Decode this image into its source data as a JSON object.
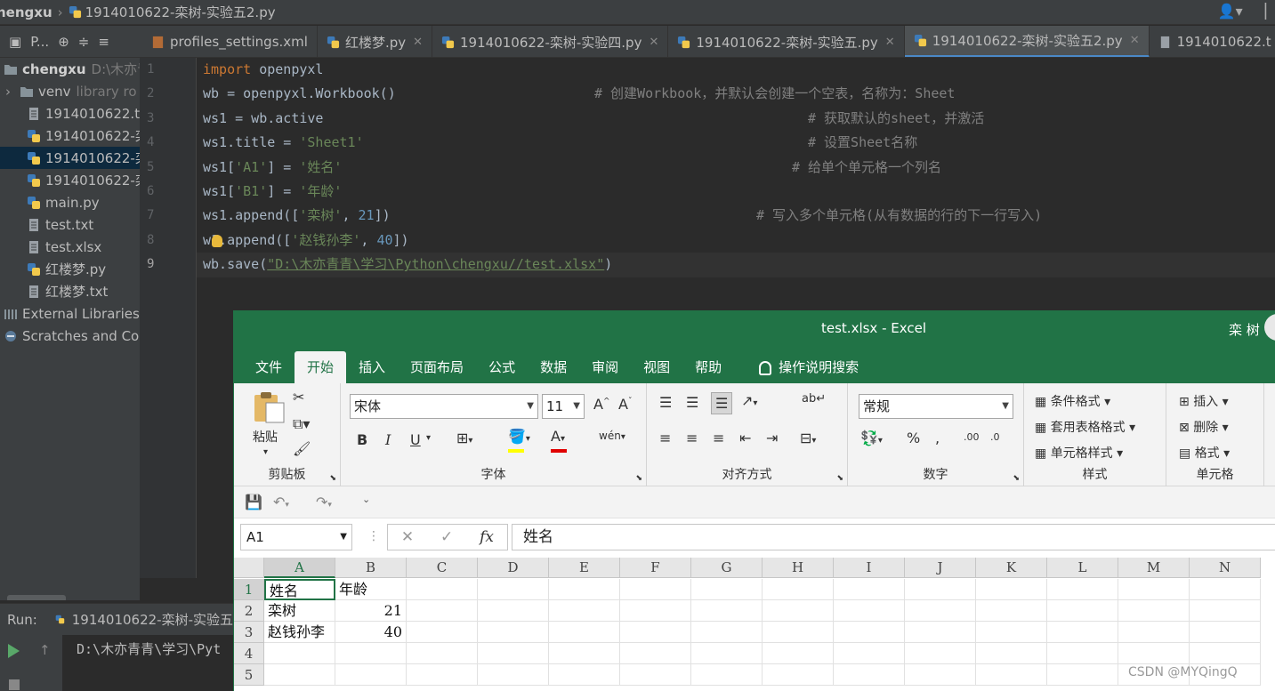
{
  "navbar": {
    "project": "hengxu",
    "file": "1914010622-栾树-实验五2.py"
  },
  "toolrow": {
    "label": "P..."
  },
  "tabs": [
    {
      "label": "profiles_settings.xml",
      "closable": false
    },
    {
      "label": "红楼梦.py",
      "closable": true
    },
    {
      "label": "1914010622-栾树-实验四.py",
      "closable": true
    },
    {
      "label": "1914010622-栾树-实验五.py",
      "closable": true
    },
    {
      "label": "1914010622-栾树-实验五2.py",
      "closable": true,
      "active": true
    },
    {
      "label": "1914010622.t",
      "closable": false
    }
  ],
  "tree": {
    "root": "chengxu",
    "root_path": "D:\\木亦青",
    "venv": "venv",
    "venv_hint": "library ro",
    "files": [
      "1914010622.tx",
      "1914010622-栾",
      "1914010622-栾",
      "1914010622-栾",
      "main.py",
      "test.txt",
      "test.xlsx",
      "红楼梦.py",
      "红楼梦.txt"
    ],
    "external": "External Libraries",
    "scratches": "Scratches and Cor"
  },
  "code": {
    "line_numbers": [
      "1",
      "2",
      "3",
      "4",
      "5",
      "6",
      "7",
      "8",
      "9"
    ],
    "l1_kw": "import",
    "l1_rest": " openpyxl",
    "l2": "wb = openpyxl.Workbook()",
    "l2_cmt": "# 创建Workbook，并默认会创建一个空表，名称为：Sheet",
    "l3": "ws1 = wb.active",
    "l3_cmt": "# 获取默认的sheet，并激活",
    "l4_a": "ws1.title = ",
    "l4_s": "'Sheet1'",
    "l4_cmt": "# 设置Sheet名称",
    "l5_a": "ws1[",
    "l5_s1": "'A1'",
    "l5_b": "] = ",
    "l5_s2": "'姓名'",
    "l5_cmt": "# 给单个单元格一个列名",
    "l6_a": "ws1[",
    "l6_s1": "'B1'",
    "l6_b": "] = ",
    "l6_s2": "'年龄'",
    "l7_a": "ws1.append([",
    "l7_s": "'栾树'",
    "l7_b": ", ",
    "l7_n": "21",
    "l7_c": "])",
    "l7_cmt": "# 写入多个单元格(从有数据的行的下一行写入)",
    "l8_a": "w",
    "l8_b": "1.append([",
    "l8_s": "'赵钱孙李'",
    "l8_c": ", ",
    "l8_n": "40",
    "l8_d": "])",
    "l9_a": "wb.save(",
    "l9_s": "\"D:\\木亦青青\\学习\\Python\\chengxu//test.xlsx\"",
    "l9_b": ")"
  },
  "run": {
    "label": "Run:",
    "config": "1914010622-栾树-实验五",
    "output": "D:\\木亦青青\\学习\\Pyt"
  },
  "excel": {
    "title": "test.xlsx  -  Excel",
    "user": "栾 树",
    "menu": [
      "文件",
      "开始",
      "插入",
      "页面布局",
      "公式",
      "数据",
      "审阅",
      "视图",
      "帮助",
      "操作说明搜索"
    ],
    "ribbon": {
      "paste": "粘贴",
      "clipboard": "剪贴板",
      "font_name": "宋体",
      "font_size": "11",
      "bold": "B",
      "italic": "I",
      "underline": "U",
      "font_group": "字体",
      "align_group": "对齐方式",
      "number_format": "常规",
      "number_group": "数字",
      "cond_format": "条件格式",
      "table_format": "套用表格格式",
      "cell_style": "单元格样式",
      "style_group": "样式",
      "insert": "插入",
      "delete": "删除",
      "format": "格式",
      "cells_group": "单元格"
    },
    "namebox": "A1",
    "formula": "姓名",
    "columns": [
      "A",
      "B",
      "C",
      "D",
      "E",
      "F",
      "G",
      "H",
      "I",
      "J",
      "K",
      "L",
      "M",
      "N"
    ],
    "rows": [
      "1",
      "2",
      "3",
      "4",
      "5"
    ],
    "cells": [
      [
        "姓名",
        "年龄"
      ],
      [
        "栾树",
        "21"
      ],
      [
        "赵钱孙李",
        "40"
      ]
    ]
  },
  "watermark": "CSDN @MYQingQ"
}
